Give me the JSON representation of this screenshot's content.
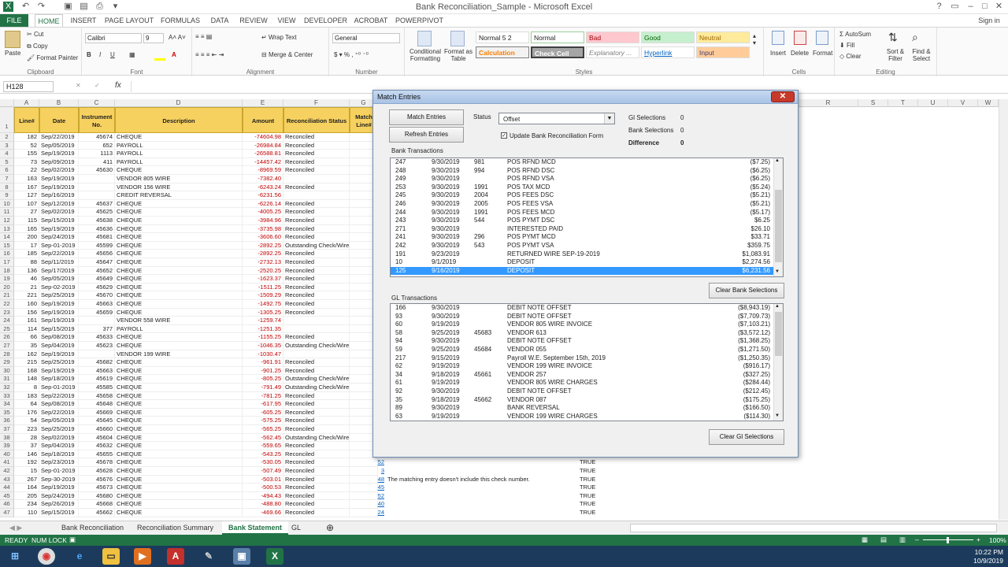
{
  "window": {
    "title": "Bank Reconciliation_Sample - Microsoft Excel"
  },
  "ribbon": {
    "tabs": [
      "FILE",
      "HOME",
      "INSERT",
      "PAGE LAYOUT",
      "FORMULAS",
      "DATA",
      "REVIEW",
      "VIEW",
      "DEVELOPER",
      "ACROBAT",
      "POWERPIVOT"
    ],
    "user": "Sign in",
    "clipboard": {
      "paste": "Paste",
      "cut": "Cut",
      "copy": "Copy",
      "format_painter": "Format Painter",
      "label": "Clipboard"
    },
    "font": {
      "name": "Calibri",
      "size": "9",
      "label": "Font"
    },
    "alignment": {
      "wrap": "Wrap Text",
      "merge": "Merge & Center",
      "label": "Alignment"
    },
    "number": {
      "format": "General",
      "label": "Number"
    },
    "styles": {
      "cond": "Conditional Formatting",
      "table": "Format as Table",
      "items": [
        "Normal 5 2",
        "Normal",
        "Bad",
        "Good",
        "Neutral",
        "Calculation",
        "Check Cell",
        "Explanatory ...",
        "Hyperlink",
        "Input"
      ],
      "label": "Styles"
    },
    "cells": {
      "insert": "Insert",
      "delete": "Delete",
      "format": "Format",
      "label": "Cells"
    },
    "editing": {
      "autosum": "AutoSum",
      "fill": "Fill",
      "clear": "Clear",
      "sort": "Sort & Filter",
      "find": "Find & Select",
      "label": "Editing"
    }
  },
  "formula_bar": {
    "name_box": "H128",
    "fx": "fx",
    "value": ""
  },
  "grid": {
    "col_letters": [
      "A",
      "B",
      "C",
      "D",
      "E",
      "F",
      "G",
      "R",
      "S",
      "T",
      "U",
      "V",
      "W"
    ],
    "headers": [
      "Line#",
      "Date",
      "Instrument No.",
      "Description",
      "Amount",
      "Reconciliation Status",
      "Match Line#"
    ],
    "rows": [
      [
        "2",
        "182",
        "Sep/22/2019",
        "45674",
        "CHEQUE",
        "-74604.98",
        "Reconciled"
      ],
      [
        "3",
        "52",
        "Sep/05/2019",
        "652",
        "PAYROLL",
        "-26984.84",
        "Reconciled"
      ],
      [
        "4",
        "155",
        "Sep/19/2019",
        "1113",
        "PAYROLL",
        "-26588.81",
        "Reconciled"
      ],
      [
        "5",
        "73",
        "Sep/09/2019",
        "411",
        "PAYROLL",
        "-14457.42",
        "Reconciled"
      ],
      [
        "6",
        "22",
        "Sep/02/2019",
        "45630",
        "CHEQUE",
        "-8969.59",
        "Reconciled"
      ],
      [
        "7",
        "163",
        "Sep/19/2019",
        "",
        "VENDOR 805 WIRE",
        "-7382.40",
        ""
      ],
      [
        "8",
        "167",
        "Sep/19/2019",
        "",
        "VENDOR 156 WIRE",
        "-6243.24",
        "Reconciled"
      ],
      [
        "9",
        "127",
        "Sep/16/2019",
        "",
        "CREDIT REVERSAL",
        "-6231.56",
        ""
      ],
      [
        "10",
        "107",
        "Sep/12/2019",
        "45637",
        "CHEQUE",
        "-6226.14",
        "Reconciled"
      ],
      [
        "11",
        "27",
        "Sep/02/2019",
        "45625",
        "CHEQUE",
        "-4005.25",
        "Reconciled"
      ],
      [
        "12",
        "115",
        "Sep/15/2019",
        "45638",
        "CHEQUE",
        "-3984.96",
        "Reconciled"
      ],
      [
        "13",
        "165",
        "Sep/19/2019",
        "45636",
        "CHEQUE",
        "-3735.98",
        "Reconciled"
      ],
      [
        "14",
        "200",
        "Sep/24/2019",
        "45681",
        "CHEQUE",
        "-3606.60",
        "Reconciled"
      ],
      [
        "15",
        "17",
        "Sep-01-2019",
        "45599",
        "CHEQUE",
        "-2892.25",
        "Outstanding Check/Wire"
      ],
      [
        "16",
        "185",
        "Sep/22/2019",
        "45656",
        "CHEQUE",
        "-2892.25",
        "Reconciled"
      ],
      [
        "17",
        "88",
        "Sep/11/2019",
        "45647",
        "CHEQUE",
        "-2732.13",
        "Reconciled"
      ],
      [
        "18",
        "136",
        "Sep/17/2019",
        "45652",
        "CHEQUE",
        "-2520.25",
        "Reconciled"
      ],
      [
        "19",
        "46",
        "Sep/05/2019",
        "45649",
        "CHEQUE",
        "-1623.37",
        "Reconciled"
      ],
      [
        "20",
        "21",
        "Sep-02-2019",
        "45629",
        "CHEQUE",
        "-1511.25",
        "Reconciled"
      ],
      [
        "21",
        "221",
        "Sep/25/2019",
        "45670",
        "CHEQUE",
        "-1509.29",
        "Reconciled"
      ],
      [
        "22",
        "160",
        "Sep/19/2019",
        "45663",
        "CHEQUE",
        "-1492.75",
        "Reconciled"
      ],
      [
        "23",
        "156",
        "Sep/19/2019",
        "45659",
        "CHEQUE",
        "-1305.25",
        "Reconciled"
      ],
      [
        "24",
        "161",
        "Sep/19/2019",
        "",
        "VENDOR 558 WIRE",
        "-1259.74",
        ""
      ],
      [
        "25",
        "114",
        "Sep/15/2019",
        "377",
        "PAYROLL",
        "-1251.35",
        ""
      ],
      [
        "26",
        "66",
        "Sep/08/2019",
        "45633",
        "CHEQUE",
        "-1155.25",
        "Reconciled"
      ],
      [
        "27",
        "35",
        "Sep/04/2019",
        "45623",
        "CHEQUE",
        "-1046.35",
        "Outstanding Check/Wire"
      ],
      [
        "28",
        "162",
        "Sep/19/2019",
        "",
        "VENDOR 199 WIRE",
        "-1030.47",
        ""
      ],
      [
        "29",
        "215",
        "Sep/25/2019",
        "45682",
        "CHEQUE",
        "-961.91",
        "Reconciled"
      ],
      [
        "30",
        "168",
        "Sep/19/2019",
        "45663",
        "CHEQUE",
        "-901.25",
        "Reconciled"
      ],
      [
        "31",
        "148",
        "Sep/18/2019",
        "45619",
        "CHEQUE",
        "-805.25",
        "Outstanding Check/Wire"
      ],
      [
        "32",
        "8",
        "Sep-01-2019",
        "45585",
        "CHEQUE",
        "-791.49",
        "Outstanding Check/Wire with E"
      ],
      [
        "33",
        "183",
        "Sep/22/2019",
        "45658",
        "CHEQUE",
        "-781.25",
        "Reconciled"
      ],
      [
        "34",
        "64",
        "Sep/08/2019",
        "45648",
        "CHEQUE",
        "-617.95",
        "Reconciled"
      ],
      [
        "35",
        "176",
        "Sep/22/2019",
        "45669",
        "CHEQUE",
        "-605.25",
        "Reconciled"
      ],
      [
        "36",
        "54",
        "Sep/05/2019",
        "45645",
        "CHEQUE",
        "-575.25",
        "Reconciled"
      ],
      [
        "37",
        "223",
        "Sep/25/2019",
        "45660",
        "CHEQUE",
        "-565.25",
        "Reconciled"
      ],
      [
        "38",
        "28",
        "Sep/02/2019",
        "45604",
        "CHEQUE",
        "-562.45",
        "Outstanding Check/Wire"
      ],
      [
        "39",
        "37",
        "Sep/04/2019",
        "45632",
        "CHEQUE",
        "-559.65",
        "Reconciled"
      ],
      [
        "40",
        "146",
        "Sep/18/2019",
        "45655",
        "CHEQUE",
        "-543.25",
        "Reconciled"
      ],
      [
        "41",
        "192",
        "Sep/23/2019",
        "45678",
        "CHEQUE",
        "-530.05",
        "Reconciled"
      ],
      [
        "42",
        "15",
        "Sep-01-2019",
        "45628",
        "CHEQUE",
        "-507.49",
        "Reconciled"
      ],
      [
        "43",
        "267",
        "Sep-30-2019",
        "45676",
        "CHEQUE",
        "-503.01",
        "Reconciled"
      ],
      [
        "44",
        "164",
        "Sep/19/2019",
        "45673",
        "CHEQUE",
        "-500.53",
        "Reconciled"
      ],
      [
        "45",
        "205",
        "Sep/24/2019",
        "45680",
        "CHEQUE",
        "-494.43",
        "Reconciled"
      ],
      [
        "46",
        "234",
        "Sep/26/2019",
        "45668",
        "CHEQUE",
        "-488.80",
        "Reconciled"
      ],
      [
        "47",
        "110",
        "Sep/15/2019",
        "45662",
        "CHEQUE",
        "-469.66",
        "Reconciled"
      ]
    ],
    "extra": [
      {
        "row": "40",
        "match": "",
        "note": "",
        "truth": ""
      },
      {
        "row": "41",
        "match": "52",
        "note": "",
        "truth": "TRUE"
      },
      {
        "row": "42",
        "match": "3",
        "note": "",
        "truth": "TRUE"
      },
      {
        "row": "43",
        "match": "48",
        "note": "The matching entry doesn't include this check number.",
        "truth": "TRUE"
      },
      {
        "row": "44",
        "match": "45",
        "note": "",
        "truth": "TRUE"
      },
      {
        "row": "45",
        "match": "52",
        "note": "",
        "truth": "TRUE"
      },
      {
        "row": "46",
        "match": "40",
        "note": "",
        "truth": "TRUE"
      },
      {
        "row": "47",
        "match": "24",
        "note": "",
        "truth": "TRUE"
      }
    ]
  },
  "sheet_tabs": [
    "Bank Reconciliation",
    "Reconciliation Summary",
    "Bank Statement",
    "GL"
  ],
  "status_bar": {
    "ready": "READY",
    "numlock": "NUM LOCK",
    "zoom": "100%"
  },
  "taskbar": {
    "time": "10:22 PM",
    "date": "10/9/2019"
  },
  "dialog": {
    "title": "Match Entries",
    "match_btn": "Match Entries",
    "refresh_btn": "Refresh Entries",
    "status_label": "Status",
    "status_value": "Offset",
    "update_chk": "Update Bank Reconciliation Form",
    "gl_sel_label": "Gl Selections",
    "gl_sel_val": "0",
    "bank_sel_label": "Bank Selections",
    "bank_sel_val": "0",
    "diff_label": "Difference",
    "diff_val": "0",
    "bank_label": "Bank Transactions",
    "gl_label": "GL Transactions",
    "clear_bank": "Clear Bank Selections",
    "clear_gl": "Clear Gl Selections",
    "bank_rows": [
      [
        "247",
        "9/30/2019",
        "981",
        "POS RFND MCD",
        "($7.25)"
      ],
      [
        "248",
        "9/30/2019",
        "994",
        "POS RFND DSC",
        "($6.25)"
      ],
      [
        "249",
        "9/30/2019",
        "",
        "POS RFND VSA",
        "($6.25)"
      ],
      [
        "253",
        "9/30/2019",
        "1991",
        "POS TAX MCD",
        "($5.24)"
      ],
      [
        "245",
        "9/30/2019",
        "2004",
        "POS FEES DSC",
        "($5.21)"
      ],
      [
        "246",
        "9/30/2019",
        "2005",
        "POS FEES VSA",
        "($5.21)"
      ],
      [
        "244",
        "9/30/2019",
        "1991",
        "POS FEES MCD",
        "($5.17)"
      ],
      [
        "243",
        "9/30/2019",
        "544",
        "POS PYMT DSC",
        "$6.25"
      ],
      [
        "271",
        "9/30/2019",
        "",
        "INTERESTED PAID",
        "$26.10"
      ],
      [
        "241",
        "9/30/2019",
        "296",
        "POS PYMT MCD",
        "$33.71"
      ],
      [
        "242",
        "9/30/2019",
        "543",
        "POS PYMT VSA",
        "$359.75"
      ],
      [
        "191",
        "9/23/2019",
        "",
        "RETURNED WIRE SEP-19-2019",
        "$1,083.91"
      ],
      [
        "10",
        "9/1/2019",
        "",
        "DEPOSIT",
        "$2,274.56"
      ],
      [
        "125",
        "9/16/2019",
        "",
        "DEPOSIT",
        "$6,231.56"
      ]
    ],
    "gl_rows": [
      [
        "166",
        "9/30/2019",
        "",
        "DEBIT NOTE OFFSET",
        "($8,943.19)"
      ],
      [
        "93",
        "9/30/2019",
        "",
        "DEBIT NOTE OFFSET",
        "($7,709.73)"
      ],
      [
        "60",
        "9/19/2019",
        "",
        "VENDOR 805 WIRE INVOICE",
        "($7,103.21)"
      ],
      [
        "58",
        "9/25/2019",
        "45683",
        "VENDOR 613",
        "($3,572.12)"
      ],
      [
        "94",
        "9/30/2019",
        "",
        "DEBIT NOTE OFFSET",
        "($1,368.25)"
      ],
      [
        "59",
        "9/25/2019",
        "45684",
        "VENDOR 055",
        "($1,271.50)"
      ],
      [
        "217",
        "9/15/2019",
        "",
        "Payroll W.E. September 15th, 2019",
        "($1,250.35)"
      ],
      [
        "62",
        "9/19/2019",
        "",
        "VENDOR 199 WIRE INVOICE",
        "($916.17)"
      ],
      [
        "34",
        "9/18/2019",
        "45661",
        "VENDOR 257",
        "($327.25)"
      ],
      [
        "61",
        "9/19/2019",
        "",
        "VENDOR 805 WIRE CHARGES",
        "($284.44)"
      ],
      [
        "92",
        "9/30/2019",
        "",
        "DEBIT NOTE OFFSET",
        "($212.45)"
      ],
      [
        "35",
        "9/18/2019",
        "45662",
        "VENDOR 087",
        "($175.25)"
      ],
      [
        "89",
        "9/30/2019",
        "",
        "BANK REVERSAL",
        "($166.50)"
      ],
      [
        "63",
        "9/19/2019",
        "",
        "VENDOR 199 WIRE CHARGES",
        "($114.30)"
      ]
    ]
  }
}
